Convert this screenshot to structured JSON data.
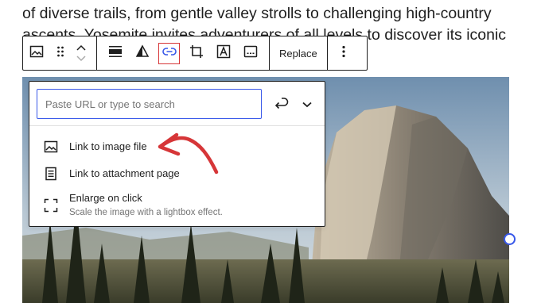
{
  "paragraph": {
    "line1": "of diverse trails, from gentle valley strolls to challenging high-country",
    "line2": "ascents. Yosemite invites adventurers of all levels to discover its iconic"
  },
  "toolbar": {
    "replace_label": "Replace",
    "icons": [
      "image-icon",
      "drag-handle-icon",
      "chevron-up-icon",
      "chevron-down-icon",
      "align-icon",
      "duotone-icon",
      "link-icon",
      "crop-icon",
      "text-overlay-icon",
      "caption-icon",
      "more-options-icon"
    ]
  },
  "link_popover": {
    "url_placeholder": "Paste URL or type to search",
    "url_value": "",
    "items": [
      {
        "label": "Link to image file",
        "icon": "image-icon"
      },
      {
        "label": "Link to attachment page",
        "icon": "page-icon"
      },
      {
        "label": "Enlarge on click",
        "description": "Scale the image with a lightbox effect.",
        "icon": "fullscreen-icon"
      }
    ]
  },
  "colors": {
    "accent_blue": "#3858e9",
    "annotation_red": "#d63638",
    "text": "#1e1e1e",
    "muted_text": "#757575"
  }
}
